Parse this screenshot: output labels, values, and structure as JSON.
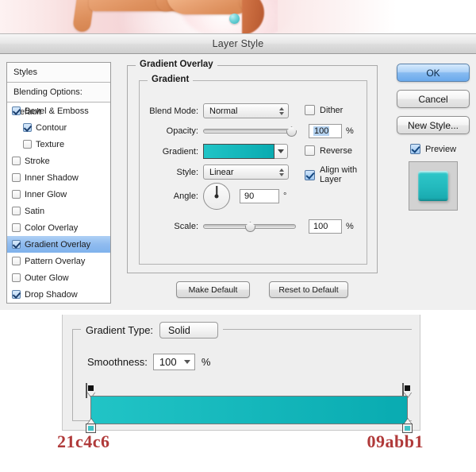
{
  "window": {
    "title": "Layer Style"
  },
  "artwork": {
    "description": "blurred-orange-rope-lettering-on-pink"
  },
  "styles_panel": {
    "header": "Styles",
    "blending_options": "Blending Options: Default",
    "effects": [
      {
        "label": "Bevel & Emboss",
        "checked": true,
        "indent": false,
        "selected": false
      },
      {
        "label": "Contour",
        "checked": true,
        "indent": true,
        "selected": false
      },
      {
        "label": "Texture",
        "checked": false,
        "indent": true,
        "selected": false
      },
      {
        "label": "Stroke",
        "checked": false,
        "indent": false,
        "selected": false
      },
      {
        "label": "Inner Shadow",
        "checked": false,
        "indent": false,
        "selected": false
      },
      {
        "label": "Inner Glow",
        "checked": false,
        "indent": false,
        "selected": false
      },
      {
        "label": "Satin",
        "checked": false,
        "indent": false,
        "selected": false
      },
      {
        "label": "Color Overlay",
        "checked": false,
        "indent": false,
        "selected": false
      },
      {
        "label": "Gradient Overlay",
        "checked": true,
        "indent": false,
        "selected": true
      },
      {
        "label": "Pattern Overlay",
        "checked": false,
        "indent": false,
        "selected": false
      },
      {
        "label": "Outer Glow",
        "checked": false,
        "indent": false,
        "selected": false
      },
      {
        "label": "Drop Shadow",
        "checked": true,
        "indent": false,
        "selected": false
      }
    ]
  },
  "gradient_overlay": {
    "group_title": "Gradient Overlay",
    "subgroup_title": "Gradient",
    "blend_mode": {
      "label": "Blend Mode:",
      "value": "Normal"
    },
    "opacity": {
      "label": "Opacity:",
      "value": "100",
      "unit": "%",
      "slider_percent": 100
    },
    "gradient": {
      "label": "Gradient:",
      "start_color": "#21c4c6",
      "end_color": "#09abb1"
    },
    "style": {
      "label": "Style:",
      "value": "Linear"
    },
    "angle": {
      "label": "Angle:",
      "value": "90",
      "unit": "°"
    },
    "scale": {
      "label": "Scale:",
      "value": "100",
      "unit": "%",
      "slider_percent": 50
    },
    "dither": {
      "label": "Dither",
      "checked": false
    },
    "reverse": {
      "label": "Reverse",
      "checked": false
    },
    "align_with_layer": {
      "label": "Align with Layer",
      "checked": true
    }
  },
  "footer_buttons": {
    "make_default": "Make Default",
    "reset_to_default": "Reset to Default"
  },
  "right_buttons": {
    "ok": "OK",
    "cancel": "Cancel",
    "new_style": "New Style...",
    "preview": {
      "label": "Preview",
      "checked": true
    },
    "preview_swatch_color": "#23b9bd"
  },
  "gradient_editor": {
    "gradient_type": {
      "label": "Gradient Type:",
      "value": "Solid"
    },
    "smoothness": {
      "label": "Smoothness:",
      "value": "100",
      "unit": "%"
    },
    "strip": {
      "start_color": "#21c4c6",
      "end_color": "#09abb1"
    },
    "opacity_stops": [
      {
        "position_percent": 0,
        "color": "#000000"
      },
      {
        "position_percent": 100,
        "color": "#000000"
      }
    ],
    "color_stops": [
      {
        "position_percent": 0,
        "color": "#21c4c6"
      },
      {
        "position_percent": 100,
        "color": "#09abb1"
      }
    ]
  },
  "hex_labels": {
    "left": "21c4c6",
    "right": "09abb1",
    "text_color": "#b03a3a"
  }
}
